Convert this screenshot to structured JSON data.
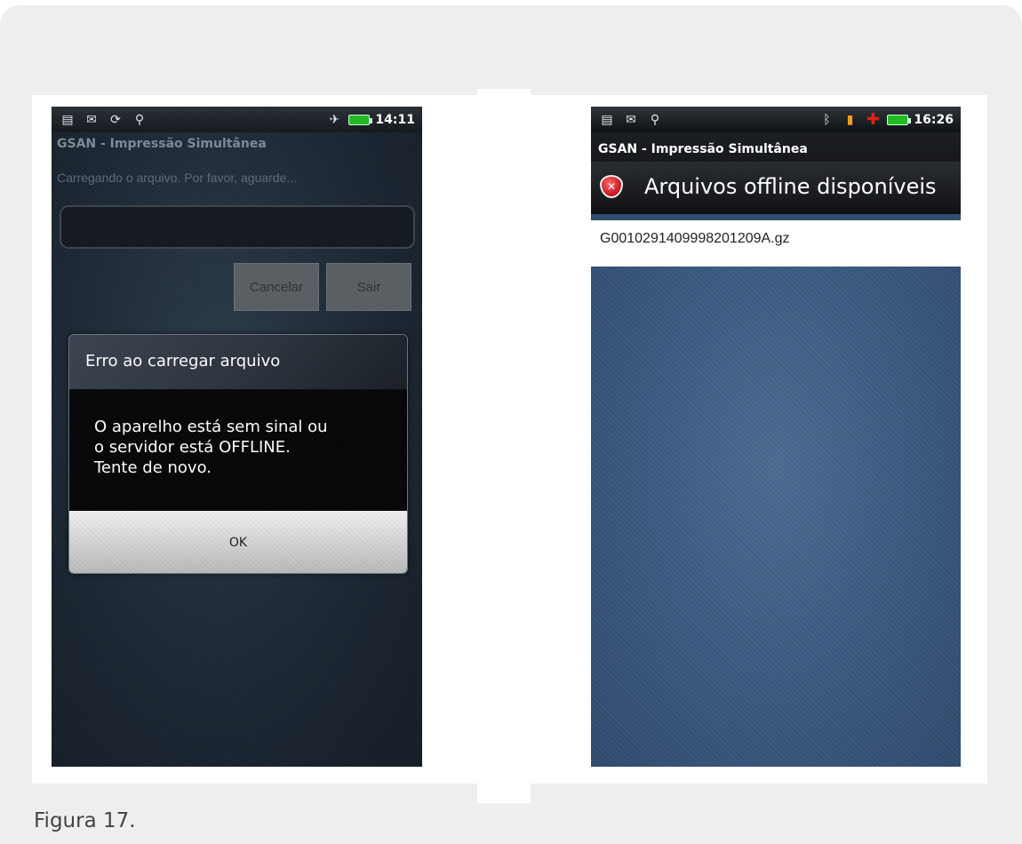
{
  "caption": "Figura 17.",
  "phone_left": {
    "status_time": "14:11",
    "app_title": "GSAN - Impressão Simultânea",
    "loading_message": "Carregando o arquivo. Por favor, aguarde...",
    "buttons": {
      "cancel": "Cancelar",
      "exit": "Sair"
    },
    "dialog": {
      "title": "Erro ao carregar arquivo",
      "message_lines": [
        "O aparelho está sem sinal ou",
        "o servidor está OFFLINE.",
        "Tente de novo."
      ],
      "ok": "OK"
    },
    "status_icons": [
      "usb-debug-icon",
      "mail-icon",
      "sync-icon",
      "usb-icon",
      "airplane-icon",
      "battery-icon"
    ]
  },
  "phone_right": {
    "status_time": "16:26",
    "app_title": "GSAN - Impressão Simultânea",
    "header_title": "Arquivos offline disponíveis",
    "files": [
      "G0010291409998201209A.gz"
    ],
    "status_icons": [
      "usb-debug-icon",
      "mail-icon",
      "usb-icon",
      "bluetooth-icon",
      "file-warning-icon",
      "medical-cross-icon",
      "battery-icon"
    ]
  }
}
